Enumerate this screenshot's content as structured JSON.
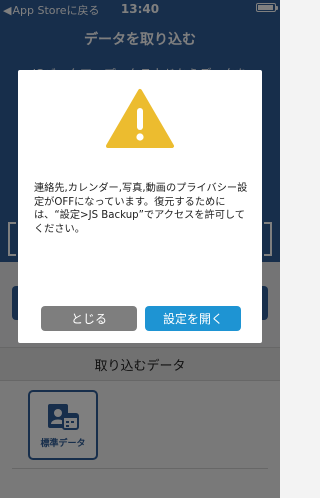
{
  "status_bar": {
    "back_label": "App Storeに戻る",
    "time": "13:40"
  },
  "nav": {
    "title": "データを取り込む"
  },
  "main": {
    "description": "JSバックアップ、クラウドからデータを"
  },
  "section": {
    "title": "取り込むデータ"
  },
  "tiles": [
    {
      "label": "標準データ",
      "icon": "contacts-calendar-icon"
    }
  ],
  "dialog": {
    "icon": "warning-icon",
    "message": "連絡先,カレンダー,写真,動画のプライバシー設定がOFFになっています。復元するためには、“設定>JS Backup”でアクセスを許可してください。",
    "close_label": "とじる",
    "open_settings_label": "設定を開く"
  },
  "colors": {
    "primary": "#2e5c97",
    "accent": "#1e94d3",
    "warning": "#ecbc2f",
    "close_button": "#7e7e7e"
  }
}
